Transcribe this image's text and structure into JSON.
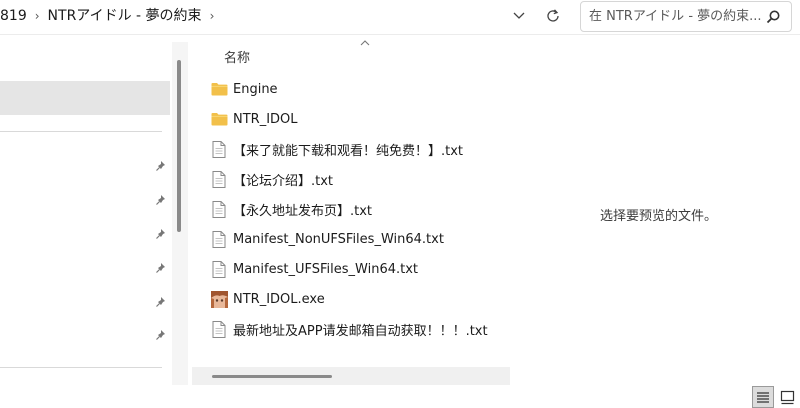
{
  "address": {
    "segments": [
      "819",
      "NTRアイドル - 夢の約束"
    ],
    "separator": "›"
  },
  "search": {
    "placeholder": "在 NTRアイドル - 夢の約束..."
  },
  "file_list": {
    "column_name": "名称",
    "items": [
      {
        "name": "Engine",
        "icon": "folder-icon"
      },
      {
        "name": "NTR_IDOL",
        "icon": "folder-icon"
      },
      {
        "name": "【来了就能下载和观看！纯免费！】.txt",
        "icon": "text-file-icon"
      },
      {
        "name": "【论坛介绍】.txt",
        "icon": "text-file-icon"
      },
      {
        "name": "【永久地址发布页】.txt",
        "icon": "text-file-icon"
      },
      {
        "name": "Manifest_NonUFSFiles_Win64.txt",
        "icon": "text-file-icon"
      },
      {
        "name": "Manifest_UFSFiles_Win64.txt",
        "icon": "text-file-icon"
      },
      {
        "name": "NTR_IDOL.exe",
        "icon": "app-icon"
      },
      {
        "name": "最新地址及APP请发邮箱自动获取！！！.txt",
        "icon": "text-file-icon"
      }
    ]
  },
  "preview": {
    "message": "选择要预览的文件。"
  },
  "colors": {
    "folder": "#f2c04a",
    "selection": "#e5e5e5",
    "accent": "#1b1b1b"
  }
}
